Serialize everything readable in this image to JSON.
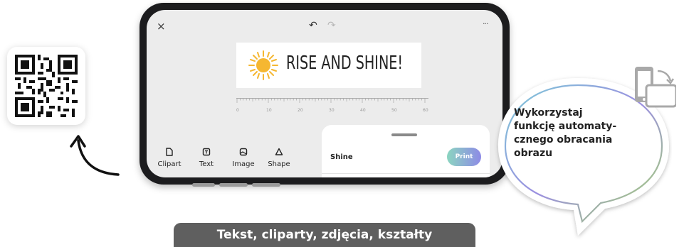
{
  "qr": {
    "icon": "qr-code-icon"
  },
  "app": {
    "close_icon": "×",
    "undo_icon": "↶",
    "redo_icon": "↷",
    "more_icon": "···",
    "label_text": "RISE AND SHINE!",
    "ruler_marks": [
      "0",
      "10",
      "20",
      "30",
      "40",
      "50",
      "60"
    ],
    "tools": [
      {
        "label": "Clipart",
        "icon": "clipart-icon"
      },
      {
        "label": "Text",
        "icon": "text-icon"
      },
      {
        "label": "Image",
        "icon": "image-icon"
      },
      {
        "label": "Shape",
        "icon": "shape-icon"
      }
    ],
    "sheet": {
      "title": "Shine",
      "print_label": "Print"
    }
  },
  "callout": {
    "text_lines": [
      "Wykorzystaj",
      "funkcję automaty-",
      "cznego obracania",
      "obrazu"
    ],
    "icon": "rotate-phone-icon"
  },
  "caption": "Tekst, cliparty, zdjęcia, kształty",
  "colors": {
    "caption_bg": "#5f5f5f",
    "print_gradient_start": "#8bd5c0",
    "print_gradient_end": "#8d8ae6",
    "phone_frame": "#1c1c1e",
    "sun": "#f5b731"
  }
}
